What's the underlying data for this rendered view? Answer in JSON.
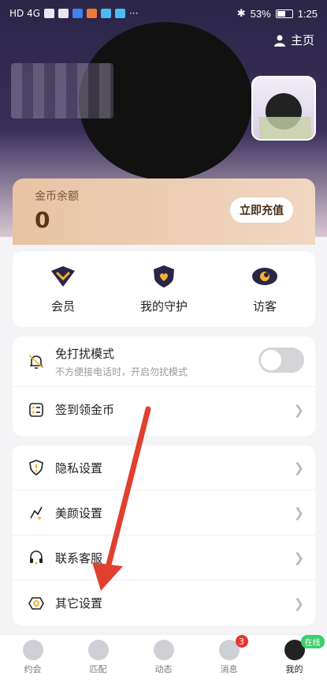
{
  "statusbar": {
    "left_text": "HD 4G",
    "battery": "53%",
    "time": "1:25"
  },
  "header": {
    "home_label": "主页"
  },
  "coins": {
    "label": "金币余额",
    "value": "0",
    "recharge_label": "立即充值"
  },
  "quick_actions": [
    {
      "label": "会员",
      "icon": "vip-icon"
    },
    {
      "label": "我的守护",
      "icon": "shield-heart-icon"
    },
    {
      "label": "访客",
      "icon": "eye-icon"
    }
  ],
  "group1": {
    "dnd": {
      "label": "免打扰模式",
      "sub": "不方便接电话时，开启勿扰模式",
      "enabled": false
    },
    "checkin": {
      "label": "签到领金币"
    }
  },
  "group2": {
    "items": [
      {
        "label": "隐私设置",
        "icon": "privacy-shield-icon"
      },
      {
        "label": "美颜设置",
        "icon": "beauty-icon"
      },
      {
        "label": "联系客服",
        "icon": "headset-icon"
      },
      {
        "label": "其它设置",
        "icon": "settings-icon"
      }
    ]
  },
  "bottom_nav": {
    "items": [
      {
        "label": "约会"
      },
      {
        "label": "匹配"
      },
      {
        "label": "动态"
      },
      {
        "label": "消息",
        "badge": "3"
      },
      {
        "label": "我的",
        "tag": "在线"
      }
    ]
  },
  "colors": {
    "accent": "#f2b233",
    "header_dark": "#2b2547",
    "coin_card": "#e8c3a3",
    "annotation_arrow": "#e04030"
  }
}
